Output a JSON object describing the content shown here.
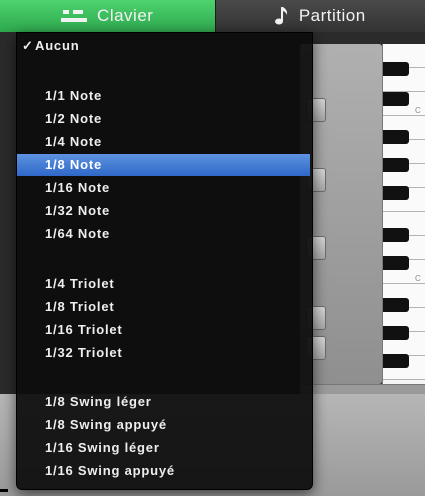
{
  "tabs": [
    {
      "label": "Clavier",
      "icon": "piano-keys-icon",
      "active": true
    },
    {
      "label": "Partition",
      "icon": "music-note-icon",
      "active": false
    }
  ],
  "colors": {
    "active_tab": "#3fc25f",
    "menu_background": "#121212",
    "menu_highlight": "#3f78d4",
    "menu_text": "#eeeeee"
  },
  "keyboard": {
    "c_labels": [
      "C",
      "C"
    ]
  },
  "quantize_menu": {
    "selected": "Aucun",
    "highlighted": "1/8 Note",
    "items": [
      {
        "label": "Aucun",
        "checked": true
      },
      {
        "label": "1/1 Note"
      },
      {
        "label": "1/2 Note"
      },
      {
        "label": "1/4 Note"
      },
      {
        "label": "1/8 Note",
        "highlighted": true
      },
      {
        "label": "1/16 Note"
      },
      {
        "label": "1/32 Note"
      },
      {
        "label": "1/64 Note"
      },
      {
        "label": "1/4 Triolet"
      },
      {
        "label": "1/8 Triolet"
      },
      {
        "label": "1/16 Triolet"
      },
      {
        "label": "1/32 Triolet"
      },
      {
        "label": "1/8 Swing léger"
      },
      {
        "label": "1/8 Swing appuyé"
      },
      {
        "label": "1/16 Swing léger"
      },
      {
        "label": "1/16 Swing appuyé"
      }
    ],
    "check_glyph": "✓"
  }
}
